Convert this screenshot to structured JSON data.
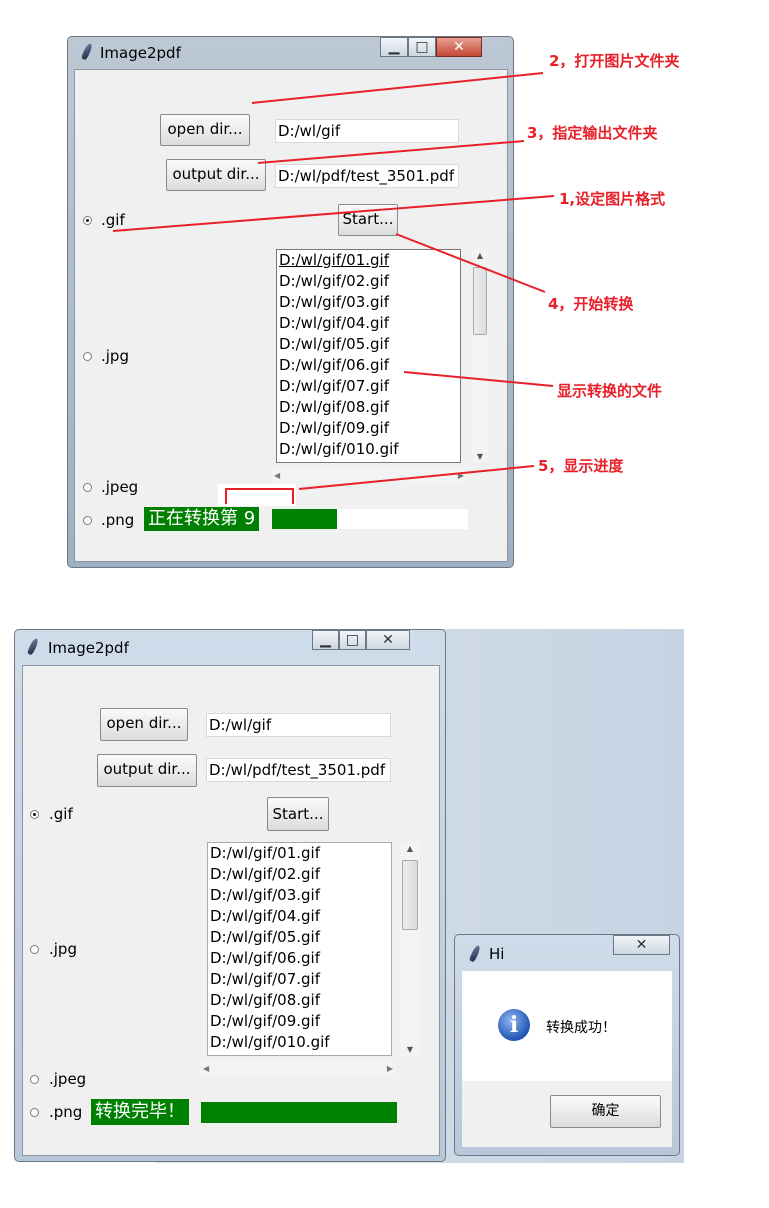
{
  "window1": {
    "title": "Image2pdf",
    "open_dir_label": "open dir...",
    "open_dir_value": "D:/wl/gif",
    "output_dir_label": "output dir...",
    "output_dir_value": "D:/wl/pdf/test_3501.pdf",
    "start_label": "Start...",
    "radios": [
      ".gif",
      ".jpg",
      ".jpeg",
      ".png"
    ],
    "selected_format": ".gif",
    "files": [
      "D:/wl/gif/01.gif",
      "D:/wl/gif/02.gif",
      "D:/wl/gif/03.gif",
      "D:/wl/gif/04.gif",
      "D:/wl/gif/05.gif",
      "D:/wl/gif/06.gif",
      "D:/wl/gif/07.gif",
      "D:/wl/gif/08.gif",
      "D:/wl/gif/09.gif",
      "D:/wl/gif/010.gif"
    ],
    "status_text": "正在转换第 9",
    "progress": 0.33
  },
  "annotations": {
    "a2": "2，打开图片文件夹",
    "a3": "3，指定输出文件夹",
    "a1": "1,设定图片格式",
    "a4": "4，开始转换",
    "a_files": "显示转换的文件",
    "a5": "5，显示进度"
  },
  "annotation_color": "#e8202a",
  "window2": {
    "title": "Image2pdf",
    "open_dir_label": "open dir...",
    "open_dir_value": "D:/wl/gif",
    "output_dir_label": "output dir...",
    "output_dir_value": "D:/wl/pdf/test_3501.pdf",
    "start_label": "Start...",
    "radios": [
      ".gif",
      ".jpg",
      ".jpeg",
      ".png"
    ],
    "selected_format": ".gif",
    "files": [
      "D:/wl/gif/01.gif",
      "D:/wl/gif/02.gif",
      "D:/wl/gif/03.gif",
      "D:/wl/gif/04.gif",
      "D:/wl/gif/05.gif",
      "D:/wl/gif/06.gif",
      "D:/wl/gif/07.gif",
      "D:/wl/gif/08.gif",
      "D:/wl/gif/09.gif",
      "D:/wl/gif/010.gif"
    ],
    "status_text": "转换完毕！",
    "progress": 1.0
  },
  "dialog": {
    "title": "Hi",
    "icon": "info-icon",
    "message": "转换成功！",
    "ok_label": "确定"
  },
  "colors": {
    "status_green": "#008000",
    "annotation_red": "#e8202a"
  }
}
